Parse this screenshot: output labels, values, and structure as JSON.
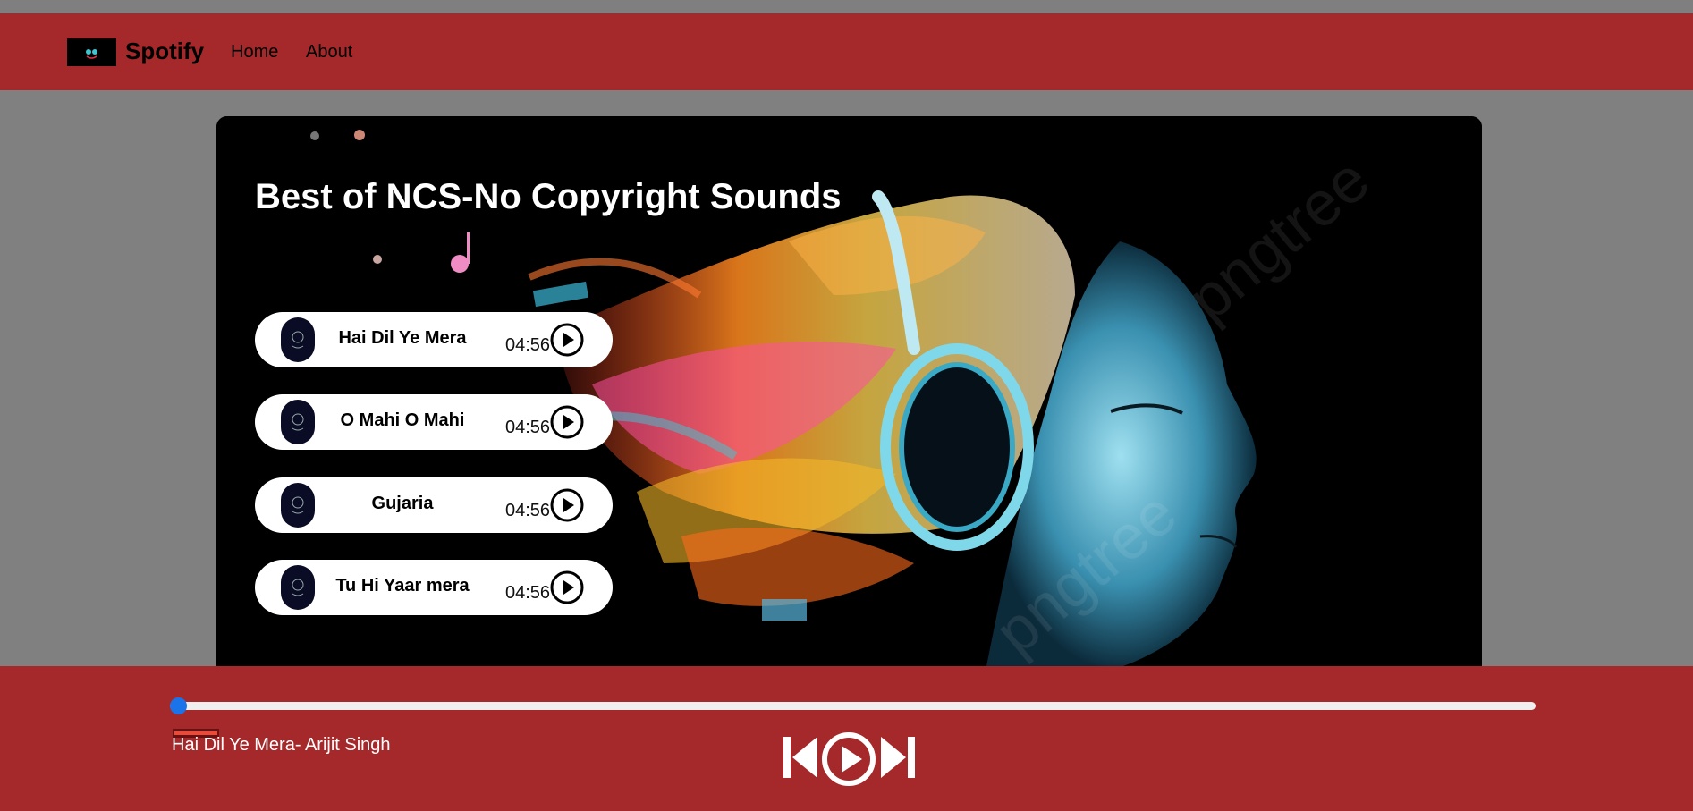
{
  "navbar": {
    "brand": "Spotify",
    "links": [
      "Home",
      "About"
    ]
  },
  "hero": {
    "title": "Best of NCS-No Copyright Sounds"
  },
  "songs": [
    {
      "title": "Hai Dil Ye Mera",
      "duration": "04:56"
    },
    {
      "title": "O Mahi O Mahi",
      "duration": "04:56"
    },
    {
      "title": "Gujaria",
      "duration": "04:56"
    },
    {
      "title": "Tu Hi Yaar mera",
      "duration": "04:56"
    }
  ],
  "player": {
    "now_playing": "Hai Dil Ye Mera- Arijit Singh",
    "progress": 0,
    "controls": [
      "previous-icon",
      "play-icon",
      "next-icon"
    ]
  },
  "colors": {
    "accent": "#a5292a",
    "background": "#808080",
    "progress_thumb": "#1a73e8"
  }
}
